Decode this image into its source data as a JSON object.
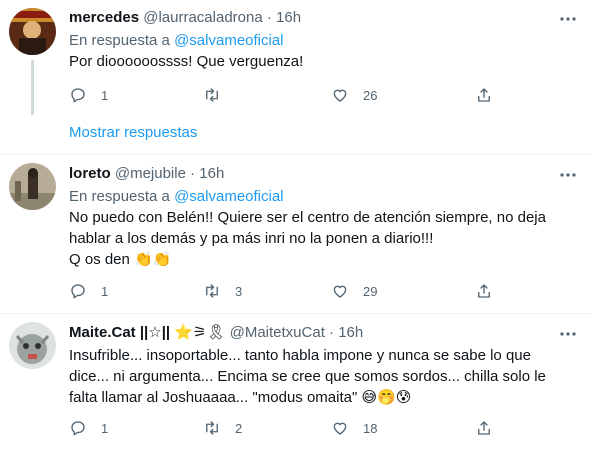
{
  "tweets": [
    {
      "name": "mercedes",
      "handle": "@laurracaladrona",
      "sep": "·",
      "time": "16h",
      "reply_prefix": "En respuesta a",
      "reply_handle": "@salvameoficial",
      "text": "Por dioooooossss! Que verguenza!",
      "replies": "1",
      "retweets": "",
      "likes": "26",
      "show_replies": "Mostrar respuestas"
    },
    {
      "name": "loreto",
      "handle": "@mejubile",
      "sep": "·",
      "time": "16h",
      "reply_prefix": "En respuesta a",
      "reply_handle": "@salvameoficial",
      "text_line1": "No puedo con Belén!! Quiere ser el centro de atención siempre, no deja",
      "text_line2": "hablar a los demás y pa más inri no la ponen a diario!!!",
      "text_line3": "Q os den",
      "text_line3_emoji": "👏👏",
      "replies": "1",
      "retweets": "3",
      "likes": "29"
    },
    {
      "name": "Maite.Cat",
      "name_suffix": "||☆||",
      "name_emoji": "⭐⚞🎗",
      "handle": "@MaitetxuCat",
      "sep": "·",
      "time": "16h",
      "text_line1": "Insufrible... insoportable... tanto habla impone y nunca se sabe lo que",
      "text_line2": "dice... ni argumenta... Encima se cree que somos sordos... chilla solo le",
      "text_line3": "falta llamar al Joshuaaaa... \"modus omaita\"",
      "text_line3_emoji": "😅🤭😰",
      "replies": "1",
      "retweets": "2",
      "likes": "18"
    }
  ],
  "icons": {
    "more": "more-icon",
    "reply": "reply-icon",
    "retweet": "retweet-icon",
    "like": "like-icon",
    "share": "share-icon"
  },
  "colors": {
    "link": "#1d9bf0",
    "secondary": "#536471",
    "text": "#0f1419",
    "divider": "#eff3f4"
  }
}
